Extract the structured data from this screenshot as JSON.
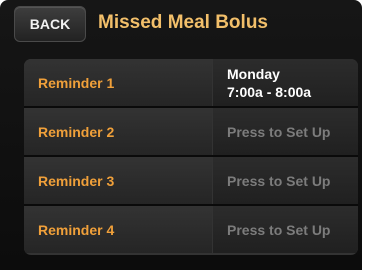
{
  "header": {
    "back_label": "BACK",
    "title": "Missed Meal Bolus"
  },
  "reminders": [
    {
      "label": "Reminder 1",
      "day": "Monday",
      "time": "7:00a - 8:00a"
    },
    {
      "label": "Reminder 2",
      "value": "Press to Set Up"
    },
    {
      "label": "Reminder 3",
      "value": "Press to Set Up"
    },
    {
      "label": "Reminder 4",
      "value": "Press to Set Up"
    }
  ],
  "colors": {
    "title": "#f2bf6a",
    "row_label": "#f0a03a",
    "placeholder_text": "#7c7c7c"
  }
}
